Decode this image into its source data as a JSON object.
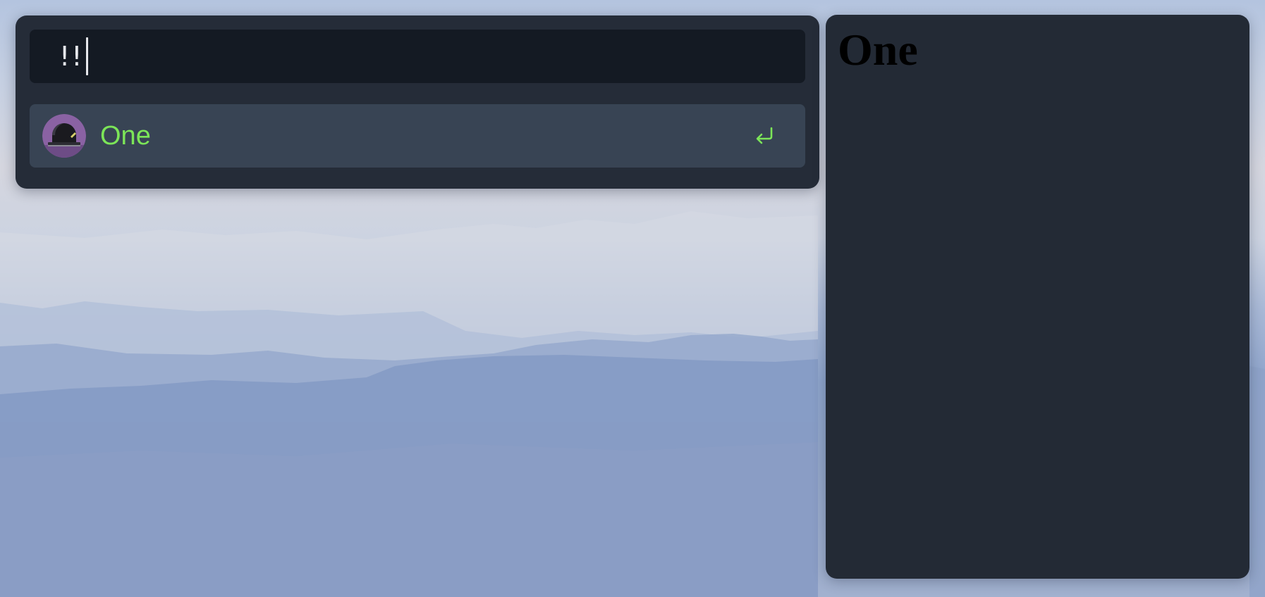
{
  "launcher": {
    "search": {
      "value": "!!"
    },
    "results": [
      {
        "label": "One",
        "icon": "app-avatar-icon",
        "action_icon": "enter-return-icon",
        "selected": true
      }
    ]
  },
  "preview": {
    "heading": "One"
  },
  "colors": {
    "launcher_bg": "#252c38",
    "search_bg": "#141a23",
    "selected_item_bg": "#384454",
    "accent_green": "#7ce558",
    "avatar_purple": "#8a62a3",
    "preview_bg": "#232a35"
  }
}
